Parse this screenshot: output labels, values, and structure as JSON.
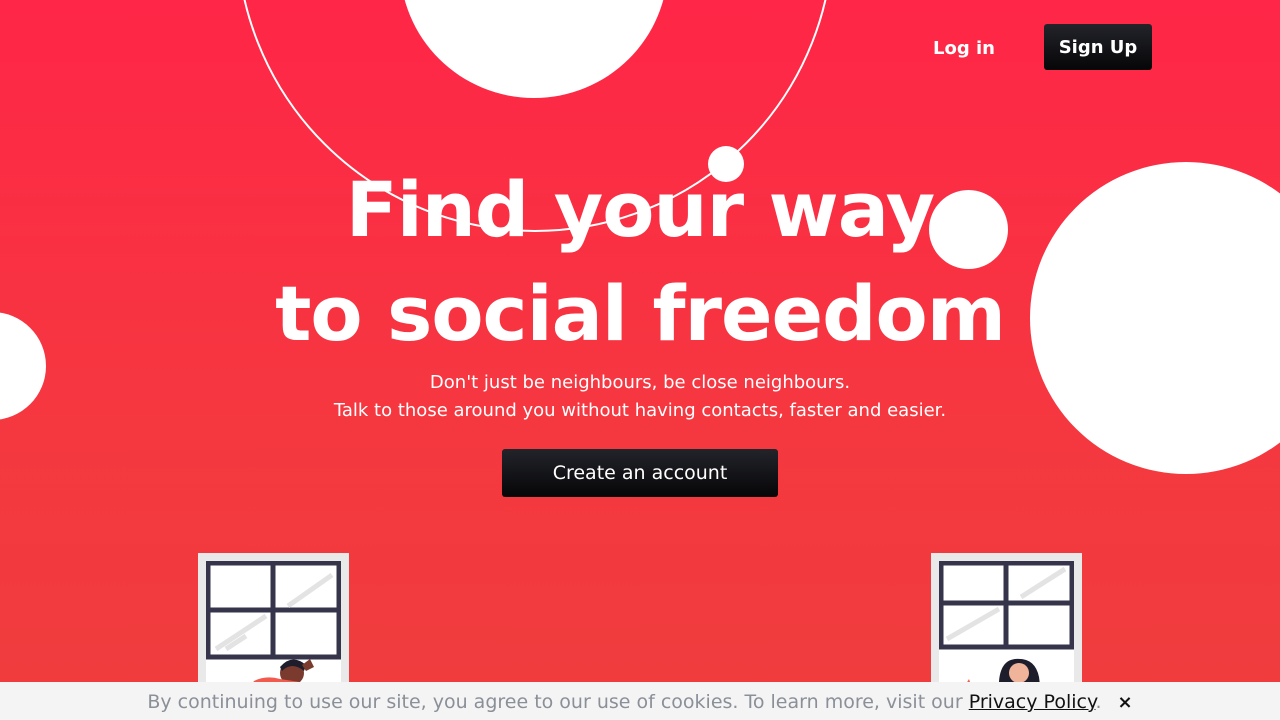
{
  "nav": {
    "login_label": "Log in",
    "signup_label": "Sign Up"
  },
  "hero": {
    "title_line1": "Find your way",
    "title_line2": "to social freedom",
    "subtitle_line1": "Don't just be neighbours, be close neighbours.",
    "subtitle_line2": "Talk to those around you without having contacts, faster and easier.",
    "cta_label": "Create an account"
  },
  "cookie_banner": {
    "text": "By continuing to use our site, you agree to our use of cookies. To learn more, visit our ",
    "link_label": "Privacy Policy",
    "trailing": ".",
    "close_icon": "×"
  },
  "colors": {
    "background_top": "#ff2647",
    "background_bottom": "#ef3d3d",
    "button_dark": "#0b0b0e",
    "text_light": "#ffffff",
    "cookie_text": "#8a8f98"
  },
  "icons": {
    "cookie_close": "close-icon"
  }
}
